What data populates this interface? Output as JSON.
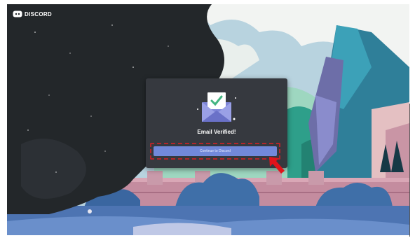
{
  "brand": {
    "name": "DISCORD"
  },
  "modal": {
    "title": "Email Verified!",
    "button_label": "Continue to Discord"
  },
  "colors": {
    "modal_bg": "#36393f",
    "button": "#7289da",
    "highlight": "#b3262b",
    "arrow": "#e0141a"
  },
  "icons": [
    "discord-logo-icon",
    "envelope-check-icon",
    "red-arrow-icon"
  ]
}
